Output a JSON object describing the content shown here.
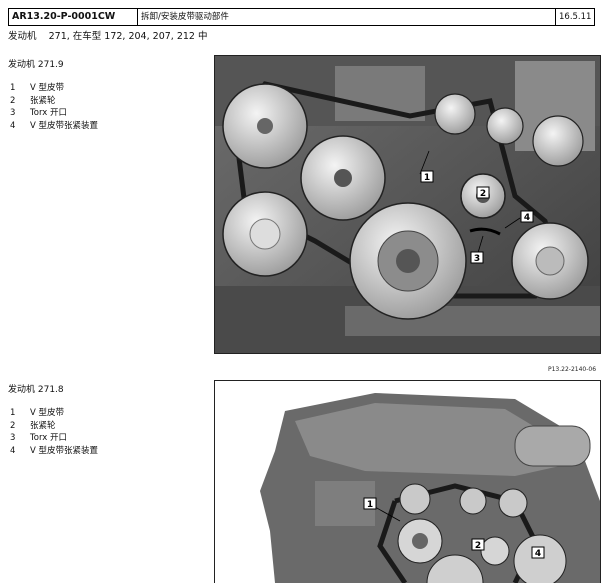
{
  "header": {
    "doc_id": "AR13.20-P-0001CW",
    "title": "拆卸/安装皮带驱动部件",
    "date": "16.5.11"
  },
  "applicability": {
    "label": "发动机",
    "text": "271, 在车型 172, 204, 207, 212 中"
  },
  "sections": [
    {
      "engine": "发动机 271.9",
      "parts": [
        {
          "num": "1",
          "label": "V 型皮带"
        },
        {
          "num": "2",
          "label": "张紧轮"
        },
        {
          "num": "3",
          "label": "Torx 开口"
        },
        {
          "num": "4",
          "label": "V 型皮带张紧装置"
        }
      ],
      "figure_code": "P13.22-2140-06",
      "callouts": [
        "1",
        "2",
        "3",
        "4"
      ]
    },
    {
      "engine": "发动机 271.8",
      "parts": [
        {
          "num": "1",
          "label": "V 型皮带"
        },
        {
          "num": "2",
          "label": "张紧轮"
        },
        {
          "num": "3",
          "label": "Torx 开口"
        },
        {
          "num": "4",
          "label": "V 型皮带张紧装置"
        }
      ],
      "callouts": [
        "1",
        "2",
        "4"
      ]
    }
  ]
}
